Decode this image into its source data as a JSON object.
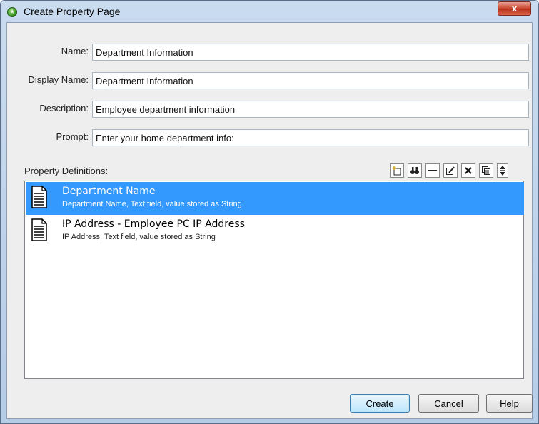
{
  "window": {
    "title": "Create Property Page",
    "close_glyph": "x",
    "icon": "star-badge-icon"
  },
  "form": {
    "name": {
      "label": "Name:",
      "value": "Department Information"
    },
    "display_name": {
      "label": "Display Name:",
      "value": "Department Information"
    },
    "description": {
      "label": "Description:",
      "value": "Employee department information"
    },
    "prompt": {
      "label": "Prompt:",
      "value": "Enter your home department info:"
    }
  },
  "property_definitions": {
    "label": "Property Definitions:",
    "toolbar": [
      "new-item-icon",
      "find-icon",
      "remove-icon",
      "edit-icon",
      "delete-icon",
      "copy-icon",
      "reorder-icon"
    ],
    "items": [
      {
        "title": "Department Name",
        "subtitle": "Department Name, Text field, value stored as String",
        "selected": true
      },
      {
        "title": "IP Address - Employee PC IP Address",
        "subtitle": "IP Address, Text field, value stored as String",
        "selected": false
      }
    ]
  },
  "buttons": {
    "create": "Create",
    "cancel": "Cancel",
    "help": "Help"
  },
  "colors": {
    "selection": "#3399ff",
    "dialog_bg": "#eeeeee",
    "titlebar": "#c9dbef"
  }
}
